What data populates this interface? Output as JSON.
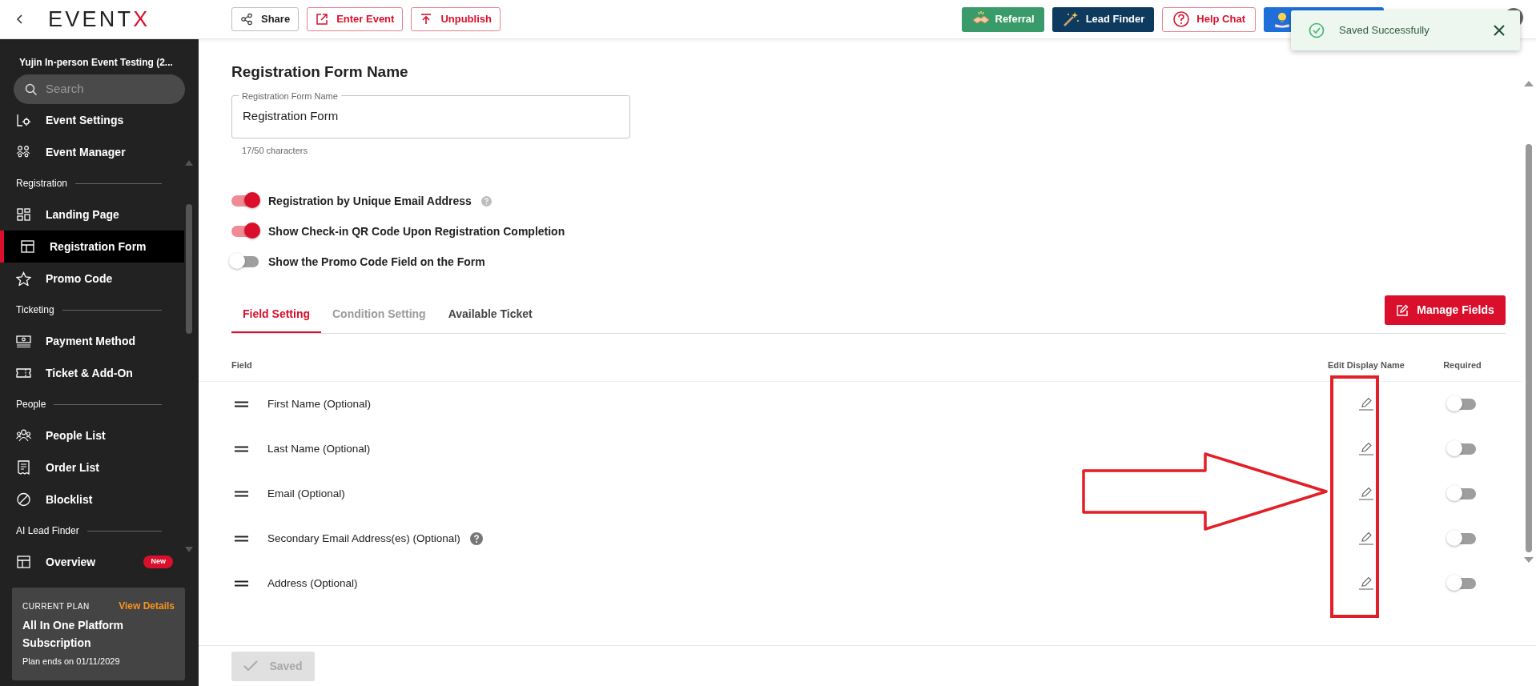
{
  "logo": {
    "text": "EVENT",
    "accent": "X"
  },
  "header": {
    "left_buttons": [
      {
        "label": "Share",
        "kind": "plain"
      },
      {
        "label": "Enter Event",
        "kind": "outline"
      },
      {
        "label": "Unpublish",
        "kind": "outline"
      }
    ],
    "right_buttons": [
      {
        "label": "Referral",
        "kind": "green"
      },
      {
        "label": "Lead Finder",
        "kind": "navy"
      },
      {
        "label": "Help Chat",
        "kind": "outline"
      },
      {
        "kind": "blue"
      }
    ]
  },
  "toast": {
    "message": "Saved Successfully"
  },
  "sidebar": {
    "event_name": "Yujin In-person Event Testing (2...",
    "search": {
      "placeholder": "Search"
    },
    "items": [
      {
        "kind": "item",
        "label": "Event Settings",
        "selected": false
      },
      {
        "kind": "item",
        "label": "Event Manager",
        "selected": false
      },
      {
        "kind": "heading",
        "label": "Registration"
      },
      {
        "kind": "item",
        "label": "Landing Page",
        "selected": false
      },
      {
        "kind": "item",
        "label": "Registration Form",
        "selected": true
      },
      {
        "kind": "item",
        "label": "Promo Code",
        "selected": false
      },
      {
        "kind": "heading",
        "label": "Ticketing"
      },
      {
        "kind": "item",
        "label": "Payment Method",
        "selected": false
      },
      {
        "kind": "item",
        "label": "Ticket & Add-On",
        "selected": false
      },
      {
        "kind": "heading",
        "label": "People"
      },
      {
        "kind": "item",
        "label": "People List",
        "selected": false
      },
      {
        "kind": "item",
        "label": "Order List",
        "selected": false
      },
      {
        "kind": "item",
        "label": "Blocklist",
        "selected": false
      },
      {
        "kind": "heading",
        "label": "AI Lead Finder"
      },
      {
        "kind": "item",
        "label": "Overview",
        "selected": false,
        "badge": "New"
      }
    ],
    "plan": {
      "caption": "CURRENT PLAN",
      "link": "View Details",
      "name": "All In One Platform Subscription",
      "ends": "Plan ends on 01/11/2029"
    }
  },
  "form": {
    "title": "Registration Form Name",
    "name_field": {
      "label": "Registration Form Name",
      "value": "Registration Form",
      "counter": "17/50 characters"
    },
    "switches": [
      {
        "label": "Registration by Unique Email Address",
        "on": true,
        "help": true
      },
      {
        "label": "Show Check-in QR Code Upon Registration Completion",
        "on": true,
        "help": false
      },
      {
        "label": "Show the Promo Code Field on the Form",
        "on": false,
        "help": false
      }
    ]
  },
  "tabs": [
    {
      "label": "Field Setting",
      "selected": true,
      "disabled": false
    },
    {
      "label": "Condition Setting",
      "selected": false,
      "disabled": true
    },
    {
      "label": "Available Ticket",
      "selected": false,
      "disabled": false
    }
  ],
  "manage_button": "Manage Fields",
  "table": {
    "columns": [
      "Field",
      "Edit Display Name",
      "Required"
    ],
    "rows": [
      {
        "field": "First Name (Optional)",
        "help": false,
        "required": false
      },
      {
        "field": "Last Name (Optional)",
        "help": false,
        "required": false
      },
      {
        "field": "Email (Optional)",
        "help": false,
        "required": false
      },
      {
        "field": "Secondary Email Address(es) (Optional)",
        "help": true,
        "required": false
      },
      {
        "field": "Address (Optional)",
        "help": false,
        "required": false
      }
    ]
  },
  "save_button": {
    "label": "Saved",
    "disabled": true
  },
  "annotations": [
    {
      "kind": "arrow"
    },
    {
      "kind": "rectangle"
    }
  ]
}
